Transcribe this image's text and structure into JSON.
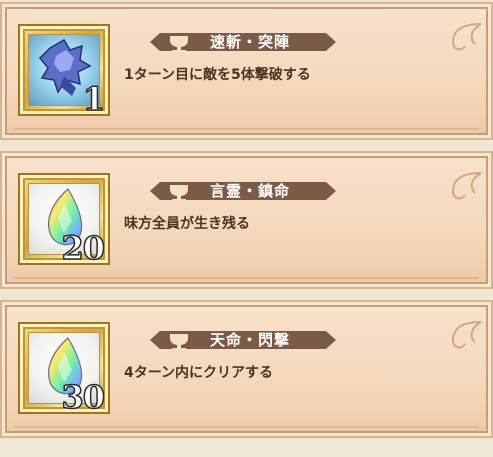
{
  "missions": [
    {
      "title": "速斬・突陣",
      "description": "1ターン目に敵を5体撃破する",
      "reward_count": "1",
      "reward_icon": "crystal-weapon-icon"
    },
    {
      "title": "言霊・鎮命",
      "description": "味方全員が生き残る",
      "reward_count": "20",
      "reward_icon": "rainbow-gem-icon"
    },
    {
      "title": "天命・閃撃",
      "description": "4ターン内にクリアする",
      "reward_count": "30",
      "reward_icon": "rainbow-gem-icon"
    }
  ],
  "colors": {
    "banner": "#7b5a46",
    "text": "#4a3424",
    "frame_gold": "#d3a63e"
  }
}
